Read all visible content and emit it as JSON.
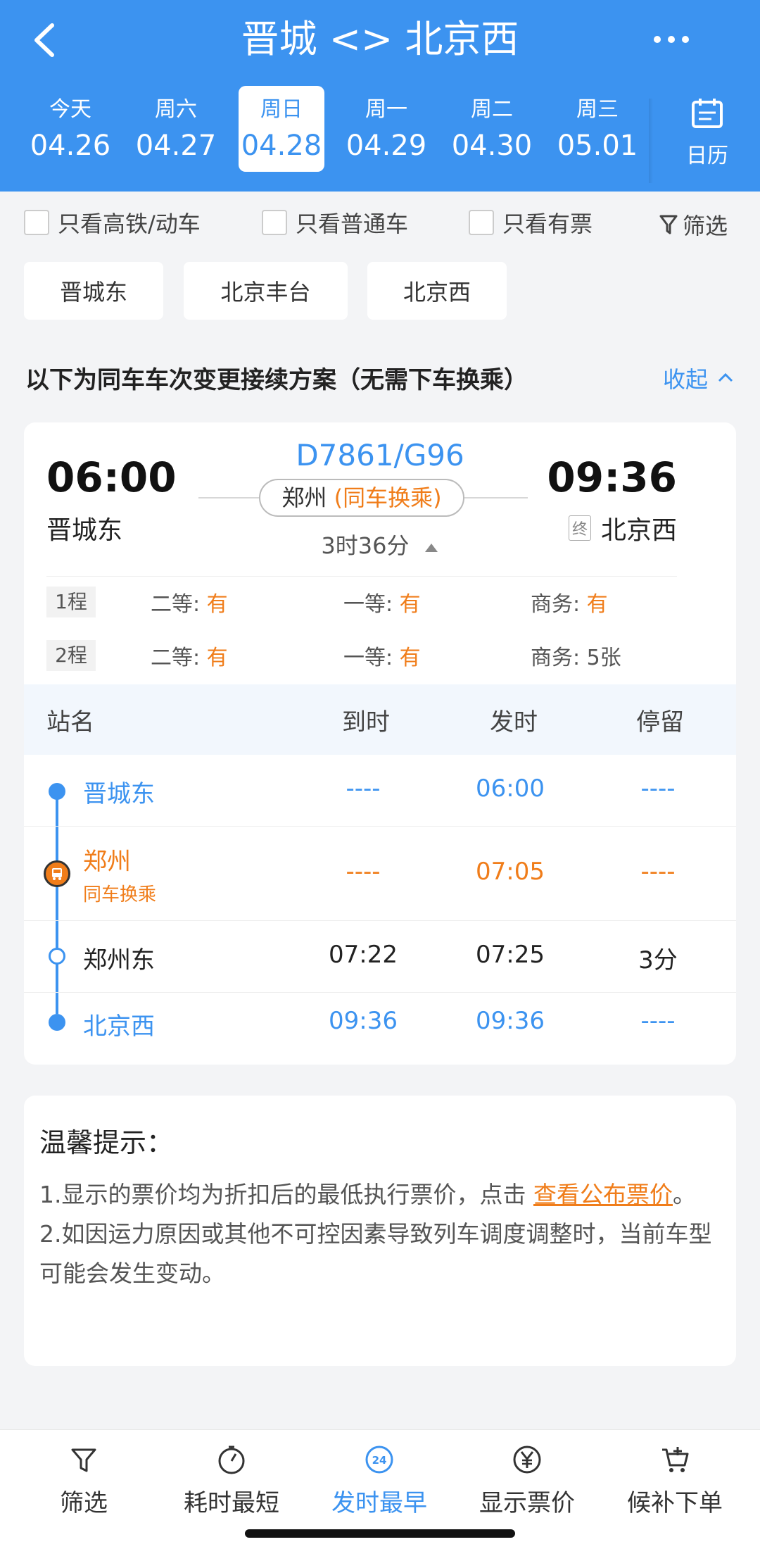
{
  "header": {
    "title": "晋城 <> 北京西",
    "dates": [
      {
        "weekday": "今天",
        "date": "04.26"
      },
      {
        "weekday": "周六",
        "date": "04.27"
      },
      {
        "weekday": "周日",
        "date": "04.28",
        "active": true
      },
      {
        "weekday": "周一",
        "date": "04.29"
      },
      {
        "weekday": "周二",
        "date": "04.30"
      },
      {
        "weekday": "周三",
        "date": "05.01"
      }
    ],
    "calendar_label": "日历"
  },
  "filters": {
    "high_speed": "只看高铁/动车",
    "normal": "只看普通车",
    "available": "只看有票",
    "filter_button": "筛选"
  },
  "stations": [
    "晋城东",
    "北京丰台",
    "北京西"
  ],
  "plan": {
    "title": "以下为同车车次变更接续方案（无需下车换乘）",
    "collapse": "收起"
  },
  "train": {
    "number": "D7861/G96",
    "dep_time": "06:00",
    "dep_station": "晋城东",
    "arr_time": "09:36",
    "arr_station": "北京西",
    "terminal_tag": "终",
    "transfer_city": "郑州",
    "transfer_label": "(同车换乘)",
    "duration": "3时36分",
    "segments": [
      {
        "tag": "1程",
        "second_label": "二等:",
        "second": "有",
        "first_label": "一等:",
        "first": "有",
        "business_label": "商务:",
        "business": "有"
      },
      {
        "tag": "2程",
        "second_label": "二等:",
        "second": "有",
        "first_label": "一等:",
        "first": "有",
        "business_label": "商务:",
        "business": "5张"
      }
    ]
  },
  "stops_table": {
    "headers": {
      "name": "站名",
      "arrive": "到时",
      "depart": "发时",
      "stay": "停留"
    },
    "rows": [
      {
        "name": "晋城东",
        "arrive": "----",
        "depart": "06:00",
        "stay": "----"
      },
      {
        "name": "郑州",
        "sub": "同车换乘",
        "arrive": "----",
        "depart": "07:05",
        "stay": "----"
      },
      {
        "name": "郑州东",
        "arrive": "07:22",
        "depart": "07:25",
        "stay": "3分"
      },
      {
        "name": "北京西",
        "arrive": "09:36",
        "depart": "09:36",
        "stay": "----"
      }
    ]
  },
  "tips": {
    "title": "温馨提示：",
    "line1_prefix": "1.显示的票价均为折扣后的最低执行票价，点击 ",
    "line1_link": "查看公布票价",
    "line1_suffix": "。",
    "line2": "2.如因运力原因或其他不可控因素导致列车调度调整时，当前车型可能会发生变动。"
  },
  "bottom_nav": [
    {
      "label": "筛选",
      "icon": "filter-icon"
    },
    {
      "label": "耗时最短",
      "icon": "timer-icon"
    },
    {
      "label": "发时最早",
      "icon": "clock-24-icon",
      "active": true
    },
    {
      "label": "显示票价",
      "icon": "yen-icon"
    },
    {
      "label": "候补下单",
      "icon": "cart-add-icon"
    }
  ],
  "colors": {
    "primary": "#3c93f0",
    "accent": "#f07d1a"
  }
}
